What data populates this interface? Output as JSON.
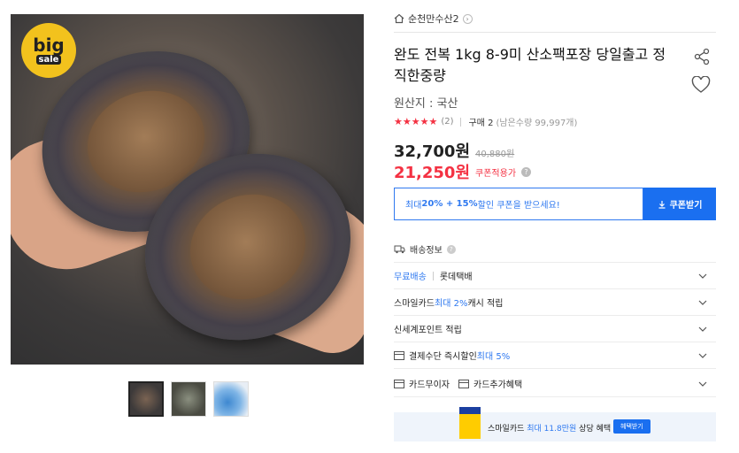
{
  "image": {
    "badge_text_top": "big",
    "badge_text_bottom": "sale",
    "thumbnails": [
      "thumb-1",
      "thumb-2",
      "thumb-3"
    ]
  },
  "store": {
    "name": "순천만수산2"
  },
  "product": {
    "title": "완도 전복 1kg 8-9미 산소팩포장 당일출고 정직한중량",
    "origin": "원산지 : 국산",
    "rating_stars": "★★★★★",
    "review_count": "(2)",
    "purchase": "구매 2",
    "remaining": "(남은수량 99,997개)",
    "price": "32,700원",
    "original_price": "40,880원",
    "coupon_price": "21,250원",
    "coupon_price_label": "쿠폰적용가"
  },
  "coupon": {
    "text_prefix": "최대 ",
    "text_bold": "20% + 15%",
    "text_suffix": " 할인 쿠폰을 받으세요!",
    "button": "쿠폰받기"
  },
  "shipping": {
    "label": "배송정보",
    "rows": [
      {
        "label_blue": "무료배송",
        "label": "롯데택배"
      },
      {
        "label": "스마일카드 ",
        "label_blue": "최대 2%",
        "label_suffix": " 캐시 적립"
      },
      {
        "label": "신세계포인트 적립"
      },
      {
        "label": "결제수단 즉시할인 ",
        "label_blue": "최대 5%"
      },
      {
        "label": "카드무이자",
        "label2": "카드추가혜택"
      }
    ]
  },
  "banner": {
    "text": "스마일카드 ",
    "text_blue": "최대 11.8만원",
    "text_suffix": " 상당 혜택",
    "button": "혜택받기"
  },
  "colors": {
    "accent": "#2f79f0",
    "sale": "#f43142",
    "coupon_button": "#1a6ff0"
  }
}
